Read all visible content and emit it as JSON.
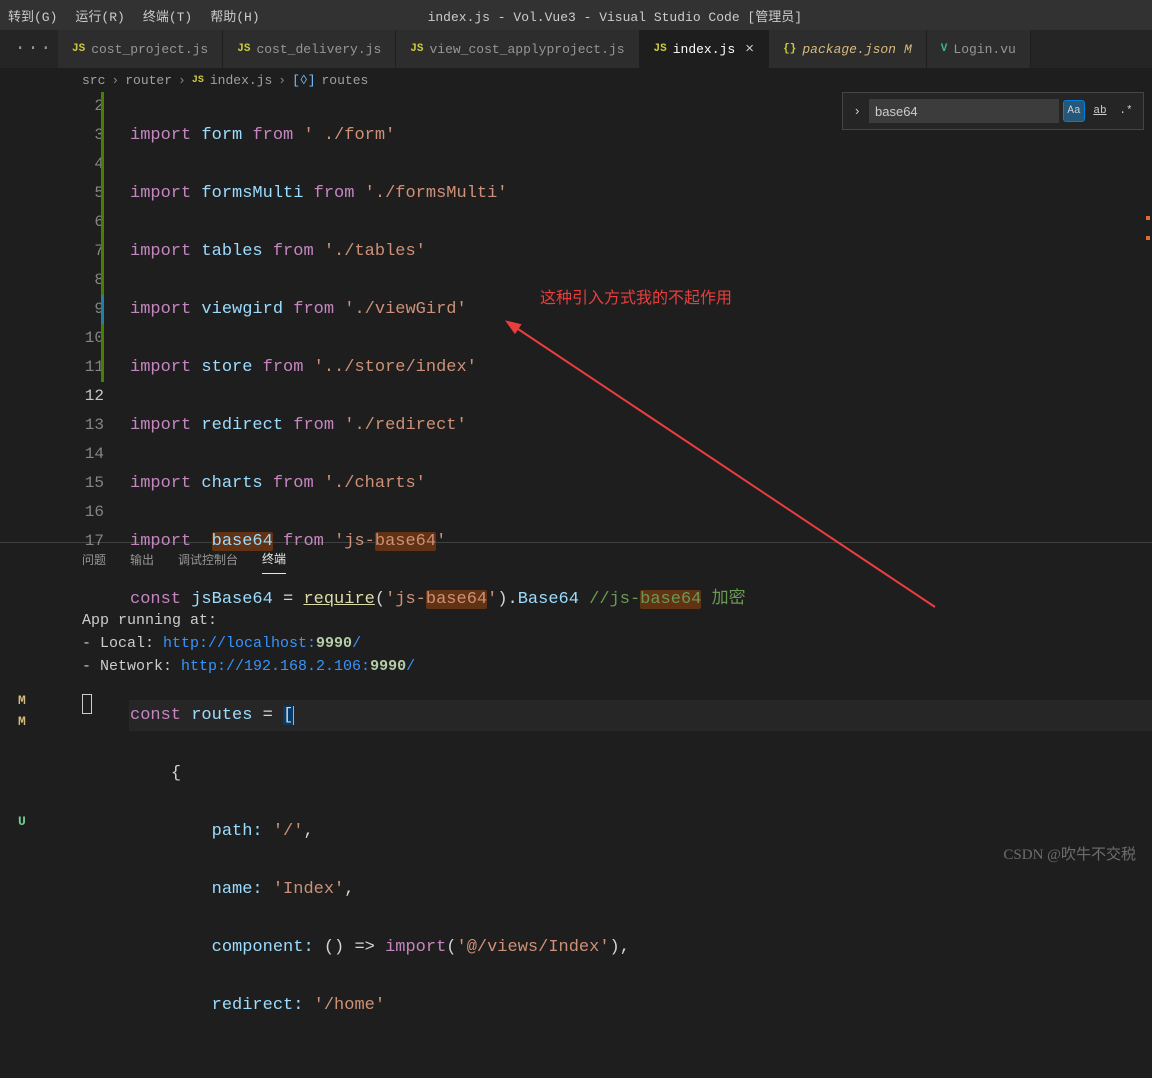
{
  "menubar": {
    "go": "转到(G)",
    "run": "运行(R)",
    "terminal": "终端(T)",
    "help": "帮助(H)"
  },
  "title": "index.js - Vol.Vue3 - Visual Studio Code [管理员]",
  "tabs": [
    {
      "icon": "JS",
      "label": "cost_project.js"
    },
    {
      "icon": "JS",
      "label": "cost_delivery.js"
    },
    {
      "icon": "JS",
      "label": "view_cost_applyproject.js"
    },
    {
      "icon": "JS",
      "label": "index.js",
      "active": true
    },
    {
      "icon": "{}",
      "label": "package.json",
      "mod": "M",
      "pkg": true
    },
    {
      "icon": "V",
      "label": "Login.vu"
    }
  ],
  "breadcrumb": {
    "p0": "src",
    "p1": "router",
    "file": "index.js",
    "sym": "routes"
  },
  "activity": {
    "m1": "M",
    "m2": "M",
    "u": "U"
  },
  "search": {
    "value": "base64",
    "aa": "Aa",
    "ab": "ab"
  },
  "annotation": "这种引入方式我的不起作用",
  "lines": [
    {
      "n": "2",
      "t": "import",
      "v": "form",
      "f": "from",
      "s": "' ./form'"
    },
    {
      "n": "3",
      "t": "import",
      "v": "formsMulti",
      "f": "from",
      "s": "'./formsMulti'"
    },
    {
      "n": "4",
      "t": "import",
      "v": "tables",
      "f": "from",
      "s": "'./tables'"
    },
    {
      "n": "5",
      "t": "import",
      "v": "viewgird",
      "f": "from",
      "s": "'./viewGird'"
    },
    {
      "n": "6",
      "t": "import",
      "v": "store",
      "f": "from",
      "s": "'../store/index'"
    },
    {
      "n": "7",
      "t": "import",
      "v": "redirect",
      "f": "from",
      "s": "'./redirect'"
    },
    {
      "n": "8",
      "t": "import",
      "v": "charts",
      "f": "from",
      "s": "'./charts'"
    }
  ],
  "line9": {
    "imp": "import",
    "base": "base64",
    "from": "from",
    "s1": "'js-",
    "base2": "base64",
    "s2": "'"
  },
  "line10": {
    "const": "const",
    "jsb": "jsBase64",
    "eq": " = ",
    "req": "require",
    "p1": "(",
    "s1": "'js-",
    "base": "base64",
    "s2": "'",
    "p2": ").",
    "b64": "Base64",
    "cmt1": " //js-",
    "cmt2": "base64",
    "cmt3": " 加密"
  },
  "line12": {
    "const": "const",
    "routes": "routes",
    "eq": " = ",
    "br": "["
  },
  "line13": "{",
  "line14": {
    "k": "path:",
    "v": "'/'",
    "c": ","
  },
  "line15": {
    "k": "name:",
    "v": "'Index'",
    "c": ","
  },
  "line16": {
    "k": "component:",
    "ar": "() => ",
    "imp": "import",
    "p": "(",
    "v": "'@/views/Index'",
    "pe": "),",
    "sp": " "
  },
  "line17": {
    "k": "redirect:",
    "v": "'/home'",
    "sp": " "
  },
  "panel": {
    "problems": "问题",
    "output": "输出",
    "debug": "调试控制台",
    "terminal": "终端"
  },
  "terminal": {
    "l1": "App running at:",
    "l2a": "- Local:   ",
    "l2b": "http://localhost:",
    "l2c": "9990",
    "l2d": "/",
    "l3a": "- Network: ",
    "l3b": "http://192.168.2.106:",
    "l3c": "9990",
    "l3d": "/"
  },
  "watermark": "CSDN @吹牛不交税"
}
